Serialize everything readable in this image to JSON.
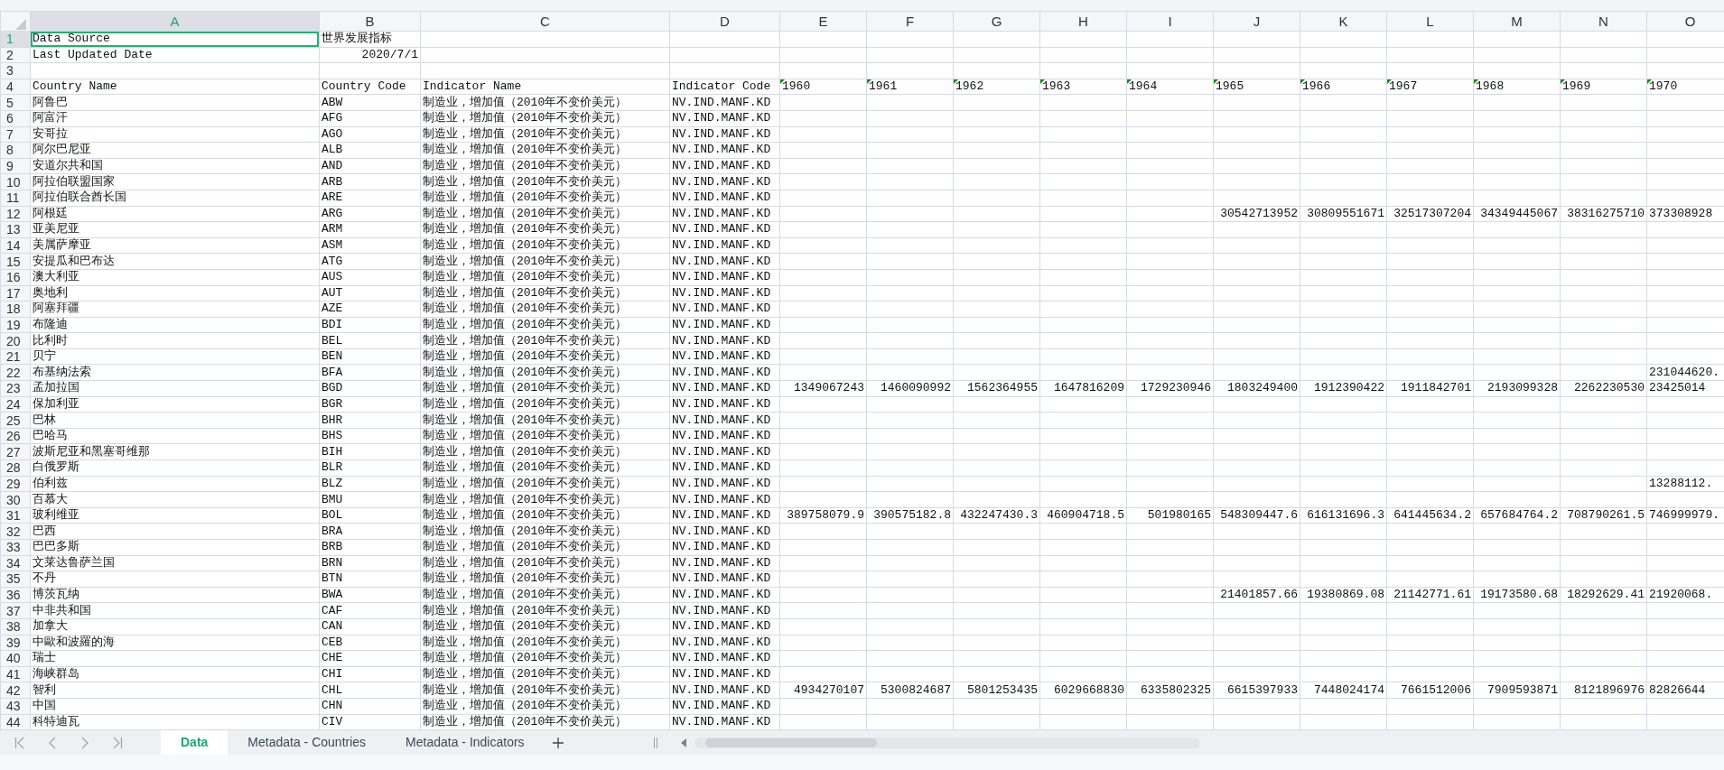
{
  "sheet": {
    "columns": [
      {
        "label": "A",
        "selected": true
      },
      {
        "label": "B",
        "selected": false
      },
      {
        "label": "C",
        "selected": false
      },
      {
        "label": "D",
        "selected": false
      },
      {
        "label": "E",
        "selected": false
      },
      {
        "label": "F",
        "selected": false
      },
      {
        "label": "G",
        "selected": false
      },
      {
        "label": "H",
        "selected": false
      },
      {
        "label": "I",
        "selected": false
      },
      {
        "label": "J",
        "selected": false
      },
      {
        "label": "K",
        "selected": false
      },
      {
        "label": "L",
        "selected": false
      },
      {
        "label": "M",
        "selected": false
      },
      {
        "label": "N",
        "selected": false
      },
      {
        "label": "O",
        "selected": false
      }
    ],
    "rows": [
      {
        "number": "1",
        "selected": true,
        "cells": {
          "A": "Data Source",
          "B": "世界发展指标"
        }
      },
      {
        "number": "2",
        "selected": false,
        "cells": {
          "A": "Last Updated Date",
          "B": {
            "text": "2020/7/1",
            "kind": "number"
          }
        }
      },
      {
        "number": "3",
        "selected": false
      },
      {
        "number": "4",
        "selected": false,
        "cells": {
          "A": "Country Name",
          "B": "Country Code",
          "C": "Indicator Name",
          "D": "Indicator Code",
          "E": {
            "text": "1960",
            "marked": true
          },
          "F": {
            "text": "1961",
            "marked": true
          },
          "G": {
            "text": "1962",
            "marked": true
          },
          "H": {
            "text": "1963",
            "marked": true
          },
          "I": {
            "text": "1964",
            "marked": true
          },
          "J": {
            "text": "1965",
            "marked": true
          },
          "K": {
            "text": "1966",
            "marked": true
          },
          "L": {
            "text": "1967",
            "marked": true
          },
          "M": {
            "text": "1968",
            "marked": true
          },
          "N": {
            "text": "1969",
            "marked": true
          },
          "O": {
            "text": "1970",
            "marked": true
          }
        }
      },
      {
        "number": "5",
        "selected": false,
        "cells": {
          "A": "阿鲁巴",
          "B": "ABW",
          "C": "制造业，增加值（2010年不变价美元）",
          "D": "NV.IND.MANF.KD"
        }
      },
      {
        "number": "6",
        "selected": false,
        "cells": {
          "A": "阿富汗",
          "B": "AFG",
          "C": "制造业，增加值（2010年不变价美元）",
          "D": "NV.IND.MANF.KD"
        }
      },
      {
        "number": "7",
        "selected": false,
        "cells": {
          "A": "安哥拉",
          "B": "AGO",
          "C": "制造业，增加值（2010年不变价美元）",
          "D": "NV.IND.MANF.KD"
        }
      },
      {
        "number": "8",
        "selected": false,
        "cells": {
          "A": "阿尔巴尼亚",
          "B": "ALB",
          "C": "制造业，增加值（2010年不变价美元）",
          "D": "NV.IND.MANF.KD"
        }
      },
      {
        "number": "9",
        "selected": false,
        "cells": {
          "A": "安道尔共和国",
          "B": "AND",
          "C": "制造业，增加值（2010年不变价美元）",
          "D": "NV.IND.MANF.KD"
        }
      },
      {
        "number": "10",
        "selected": false,
        "cells": {
          "A": "阿拉伯联盟国家",
          "B": "ARB",
          "C": "制造业，增加值（2010年不变价美元）",
          "D": "NV.IND.MANF.KD"
        }
      },
      {
        "number": "11",
        "selected": false,
        "cells": {
          "A": "阿拉伯联合酋长国",
          "B": "ARE",
          "C": "制造业，增加值（2010年不变价美元）",
          "D": "NV.IND.MANF.KD"
        }
      },
      {
        "number": "12",
        "selected": false,
        "cells": {
          "A": "阿根廷",
          "B": "ARG",
          "C": "制造业，增加值（2010年不变价美元）",
          "D": "NV.IND.MANF.KD",
          "J": {
            "text": "30542713952",
            "kind": "number"
          },
          "K": {
            "text": "30809551671",
            "kind": "number"
          },
          "L": {
            "text": "32517307204",
            "kind": "number"
          },
          "M": {
            "text": "34349445067",
            "kind": "number"
          },
          "N": {
            "text": "38316275710",
            "kind": "number"
          },
          "O": "373308928"
        }
      },
      {
        "number": "13",
        "selected": false,
        "cells": {
          "A": "亚美尼亚",
          "B": "ARM",
          "C": "制造业，增加值（2010年不变价美元）",
          "D": "NV.IND.MANF.KD"
        }
      },
      {
        "number": "14",
        "selected": false,
        "cells": {
          "A": "美属萨摩亚",
          "B": "ASM",
          "C": "制造业，增加值（2010年不变价美元）",
          "D": "NV.IND.MANF.KD"
        }
      },
      {
        "number": "15",
        "selected": false,
        "cells": {
          "A": "安提瓜和巴布达",
          "B": "ATG",
          "C": "制造业，增加值（2010年不变价美元）",
          "D": "NV.IND.MANF.KD"
        }
      },
      {
        "number": "16",
        "selected": false,
        "cells": {
          "A": "澳大利亚",
          "B": "AUS",
          "C": "制造业，增加值（2010年不变价美元）",
          "D": "NV.IND.MANF.KD"
        }
      },
      {
        "number": "17",
        "selected": false,
        "cells": {
          "A": "奥地利",
          "B": "AUT",
          "C": "制造业，增加值（2010年不变价美元）",
          "D": "NV.IND.MANF.KD"
        }
      },
      {
        "number": "18",
        "selected": false,
        "cells": {
          "A": "阿塞拜疆",
          "B": "AZE",
          "C": "制造业，增加值（2010年不变价美元）",
          "D": "NV.IND.MANF.KD"
        }
      },
      {
        "number": "19",
        "selected": false,
        "cells": {
          "A": "布隆迪",
          "B": "BDI",
          "C": "制造业，增加值（2010年不变价美元）",
          "D": "NV.IND.MANF.KD"
        }
      },
      {
        "number": "20",
        "selected": false,
        "cells": {
          "A": "比利时",
          "B": "BEL",
          "C": "制造业，增加值（2010年不变价美元）",
          "D": "NV.IND.MANF.KD"
        }
      },
      {
        "number": "21",
        "selected": false,
        "cells": {
          "A": "贝宁",
          "B": "BEN",
          "C": "制造业，增加值（2010年不变价美元）",
          "D": "NV.IND.MANF.KD"
        }
      },
      {
        "number": "22",
        "selected": false,
        "cells": {
          "A": "布基纳法索",
          "B": "BFA",
          "C": "制造业，增加值（2010年不变价美元）",
          "D": "NV.IND.MANF.KD",
          "O": "231044620."
        }
      },
      {
        "number": "23",
        "selected": false,
        "cells": {
          "A": "孟加拉国",
          "B": "BGD",
          "C": "制造业，增加值（2010年不变价美元）",
          "D": "NV.IND.MANF.KD",
          "E": {
            "text": "1349067243",
            "kind": "number"
          },
          "F": {
            "text": "1460090992",
            "kind": "number"
          },
          "G": {
            "text": "1562364955",
            "kind": "number"
          },
          "H": {
            "text": "1647816209",
            "kind": "number"
          },
          "I": {
            "text": "1729230946",
            "kind": "number"
          },
          "J": {
            "text": "1803249400",
            "kind": "number"
          },
          "K": {
            "text": "1912390422",
            "kind": "number"
          },
          "L": {
            "text": "1911842701",
            "kind": "number"
          },
          "M": {
            "text": "2193099328",
            "kind": "number"
          },
          "N": {
            "text": "2262230530",
            "kind": "number"
          },
          "O": "23425014"
        }
      },
      {
        "number": "24",
        "selected": false,
        "cells": {
          "A": "保加利亚",
          "B": "BGR",
          "C": "制造业，增加值（2010年不变价美元）",
          "D": "NV.IND.MANF.KD"
        }
      },
      {
        "number": "25",
        "selected": false,
        "cells": {
          "A": "巴林",
          "B": "BHR",
          "C": "制造业，增加值（2010年不变价美元）",
          "D": "NV.IND.MANF.KD"
        }
      },
      {
        "number": "26",
        "selected": false,
        "cells": {
          "A": "巴哈马",
          "B": "BHS",
          "C": "制造业，增加值（2010年不变价美元）",
          "D": "NV.IND.MANF.KD"
        }
      },
      {
        "number": "27",
        "selected": false,
        "cells": {
          "A": "波斯尼亚和黑塞哥维那",
          "B": "BIH",
          "C": "制造业，增加值（2010年不变价美元）",
          "D": "NV.IND.MANF.KD"
        }
      },
      {
        "number": "28",
        "selected": false,
        "cells": {
          "A": "白俄罗斯",
          "B": "BLR",
          "C": "制造业，增加值（2010年不变价美元）",
          "D": "NV.IND.MANF.KD"
        }
      },
      {
        "number": "29",
        "selected": false,
        "cells": {
          "A": "伯利兹",
          "B": "BLZ",
          "C": "制造业，增加值（2010年不变价美元）",
          "D": "NV.IND.MANF.KD",
          "O": "13288112."
        }
      },
      {
        "number": "30",
        "selected": false,
        "cells": {
          "A": "百慕大",
          "B": "BMU",
          "C": "制造业，增加值（2010年不变价美元）",
          "D": "NV.IND.MANF.KD"
        }
      },
      {
        "number": "31",
        "selected": false,
        "cells": {
          "A": "玻利维亚",
          "B": "BOL",
          "C": "制造业，增加值（2010年不变价美元）",
          "D": "NV.IND.MANF.KD",
          "E": {
            "text": "389758079.9",
            "kind": "number"
          },
          "F": {
            "text": "390575182.8",
            "kind": "number"
          },
          "G": {
            "text": "432247430.3",
            "kind": "number"
          },
          "H": {
            "text": "460904718.5",
            "kind": "number"
          },
          "I": {
            "text": "501980165",
            "kind": "number"
          },
          "J": {
            "text": "548309447.6",
            "kind": "number"
          },
          "K": {
            "text": "616131696.3",
            "kind": "number"
          },
          "L": {
            "text": "641445634.2",
            "kind": "number"
          },
          "M": {
            "text": "657684764.2",
            "kind": "number"
          },
          "N": {
            "text": "708790261.5",
            "kind": "number"
          },
          "O": "746999979."
        }
      },
      {
        "number": "32",
        "selected": false,
        "cells": {
          "A": "巴西",
          "B": "BRA",
          "C": "制造业，增加值（2010年不变价美元）",
          "D": "NV.IND.MANF.KD"
        }
      },
      {
        "number": "33",
        "selected": false,
        "cells": {
          "A": "巴巴多斯",
          "B": "BRB",
          "C": "制造业，增加值（2010年不变价美元）",
          "D": "NV.IND.MANF.KD"
        }
      },
      {
        "number": "34",
        "selected": false,
        "cells": {
          "A": "文莱达鲁萨兰国",
          "B": "BRN",
          "C": "制造业，增加值（2010年不变价美元）",
          "D": "NV.IND.MANF.KD"
        }
      },
      {
        "number": "35",
        "selected": false,
        "cells": {
          "A": "不丹",
          "B": "BTN",
          "C": "制造业，增加值（2010年不变价美元）",
          "D": "NV.IND.MANF.KD"
        }
      },
      {
        "number": "36",
        "selected": false,
        "cells": {
          "A": "博茨瓦纳",
          "B": "BWA",
          "C": "制造业，增加值（2010年不变价美元）",
          "D": "NV.IND.MANF.KD",
          "J": {
            "text": "21401857.66",
            "kind": "number"
          },
          "K": {
            "text": "19380869.08",
            "kind": "number"
          },
          "L": {
            "text": "21142771.61",
            "kind": "number"
          },
          "M": {
            "text": "19173580.68",
            "kind": "number"
          },
          "N": {
            "text": "18292629.41",
            "kind": "number"
          },
          "O": "21920068."
        }
      },
      {
        "number": "37",
        "selected": false,
        "cells": {
          "A": "中非共和国",
          "B": "CAF",
          "C": "制造业，增加值（2010年不变价美元）",
          "D": "NV.IND.MANF.KD"
        }
      },
      {
        "number": "38",
        "selected": false,
        "cells": {
          "A": "加拿大",
          "B": "CAN",
          "C": "制造业，增加值（2010年不变价美元）",
          "D": "NV.IND.MANF.KD"
        }
      },
      {
        "number": "39",
        "selected": false,
        "cells": {
          "A": "中歐和波羅的海",
          "B": "CEB",
          "C": "制造业，增加值（2010年不变价美元）",
          "D": "NV.IND.MANF.KD"
        }
      },
      {
        "number": "40",
        "selected": false,
        "cells": {
          "A": "瑞士",
          "B": "CHE",
          "C": "制造业，增加值（2010年不变价美元）",
          "D": "NV.IND.MANF.KD"
        }
      },
      {
        "number": "41",
        "selected": false,
        "cells": {
          "A": "海峡群岛",
          "B": "CHI",
          "C": "制造业，增加值（2010年不变价美元）",
          "D": "NV.IND.MANF.KD"
        }
      },
      {
        "number": "42",
        "selected": false,
        "cells": {
          "A": "智利",
          "B": "CHL",
          "C": "制造业，增加值（2010年不变价美元）",
          "D": "NV.IND.MANF.KD",
          "E": {
            "text": "4934270107",
            "kind": "number"
          },
          "F": {
            "text": "5300824687",
            "kind": "number"
          },
          "G": {
            "text": "5801253435",
            "kind": "number"
          },
          "H": {
            "text": "6029668830",
            "kind": "number"
          },
          "I": {
            "text": "6335802325",
            "kind": "number"
          },
          "J": {
            "text": "6615397933",
            "kind": "number"
          },
          "K": {
            "text": "7448024174",
            "kind": "number"
          },
          "L": {
            "text": "7661512006",
            "kind": "number"
          },
          "M": {
            "text": "7909593871",
            "kind": "number"
          },
          "N": {
            "text": "8121896976",
            "kind": "number"
          },
          "O": "82826644"
        }
      },
      {
        "number": "43",
        "selected": false,
        "cells": {
          "A": "中国",
          "B": "CHN",
          "C": "制造业，增加值（2010年不变价美元）",
          "D": "NV.IND.MANF.KD"
        }
      },
      {
        "number": "44",
        "selected": false,
        "cells": {
          "A": "科特迪瓦",
          "B": "CIV",
          "C": "制造业，增加值（2010年不变价美元）",
          "D": "NV.IND.MANF.KD"
        }
      }
    ]
  },
  "sheet_tabs": [
    {
      "label": "Data",
      "selected": true
    },
    {
      "label": "Metadata - Countries",
      "selected": false
    },
    {
      "label": "Metadata - Indicators",
      "selected": false
    }
  ]
}
